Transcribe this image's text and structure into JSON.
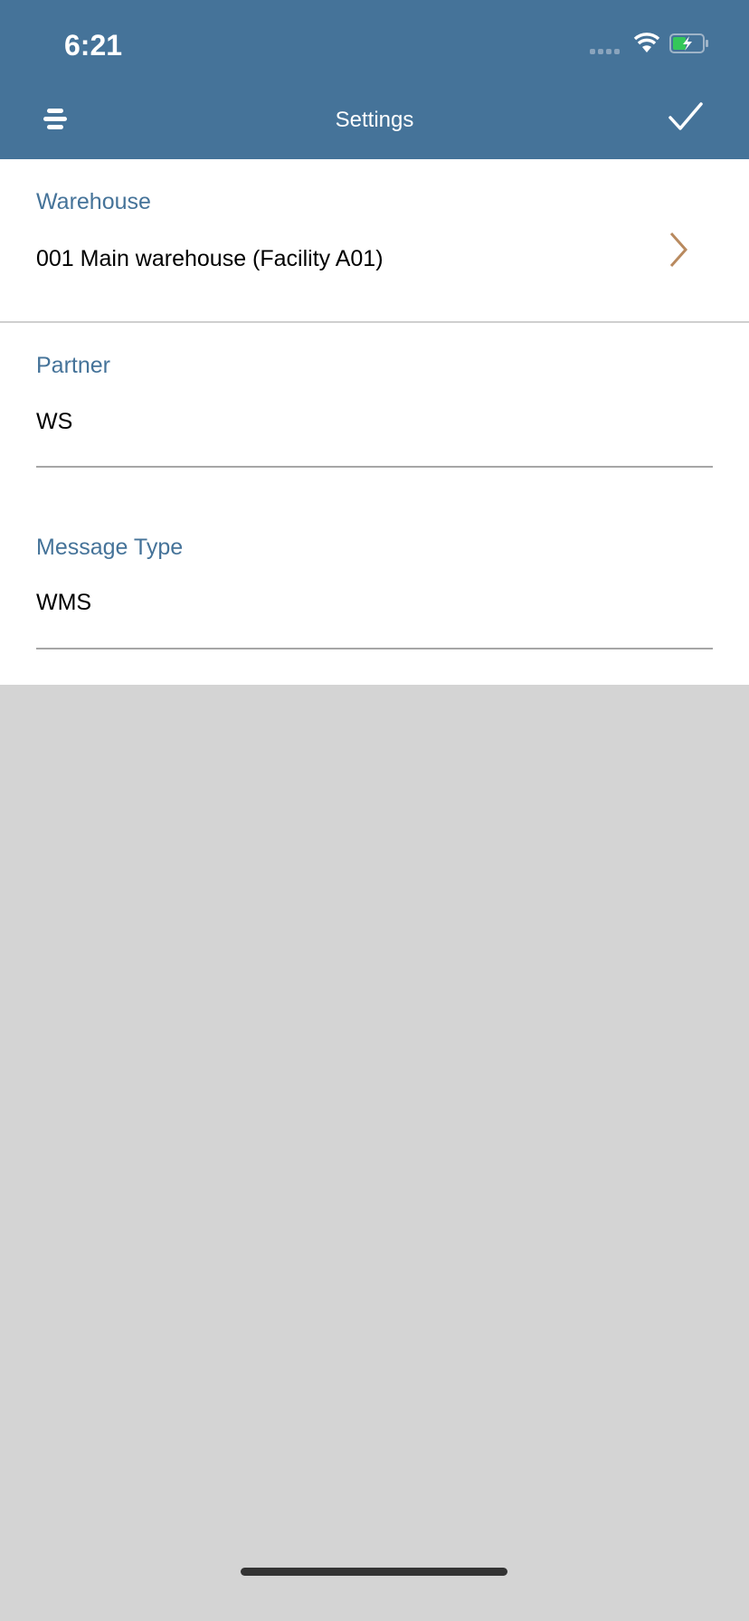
{
  "status_bar": {
    "time": "6:21",
    "battery_charging": true,
    "battery_color": "#34c759"
  },
  "header": {
    "title": "Settings",
    "menu_icon": "menu-icon",
    "confirm_icon": "checkmark-icon",
    "background": "#457399"
  },
  "fields": [
    {
      "label": "Warehouse",
      "value": "001 Main warehouse (Facility A01)",
      "icon": "chevron-right-icon"
    },
    {
      "label": "Partner",
      "value": "WS"
    },
    {
      "label": "Message Type",
      "value": "WMS"
    }
  ],
  "colors": {
    "label": "#457399",
    "chevron": "#b98a5f"
  }
}
